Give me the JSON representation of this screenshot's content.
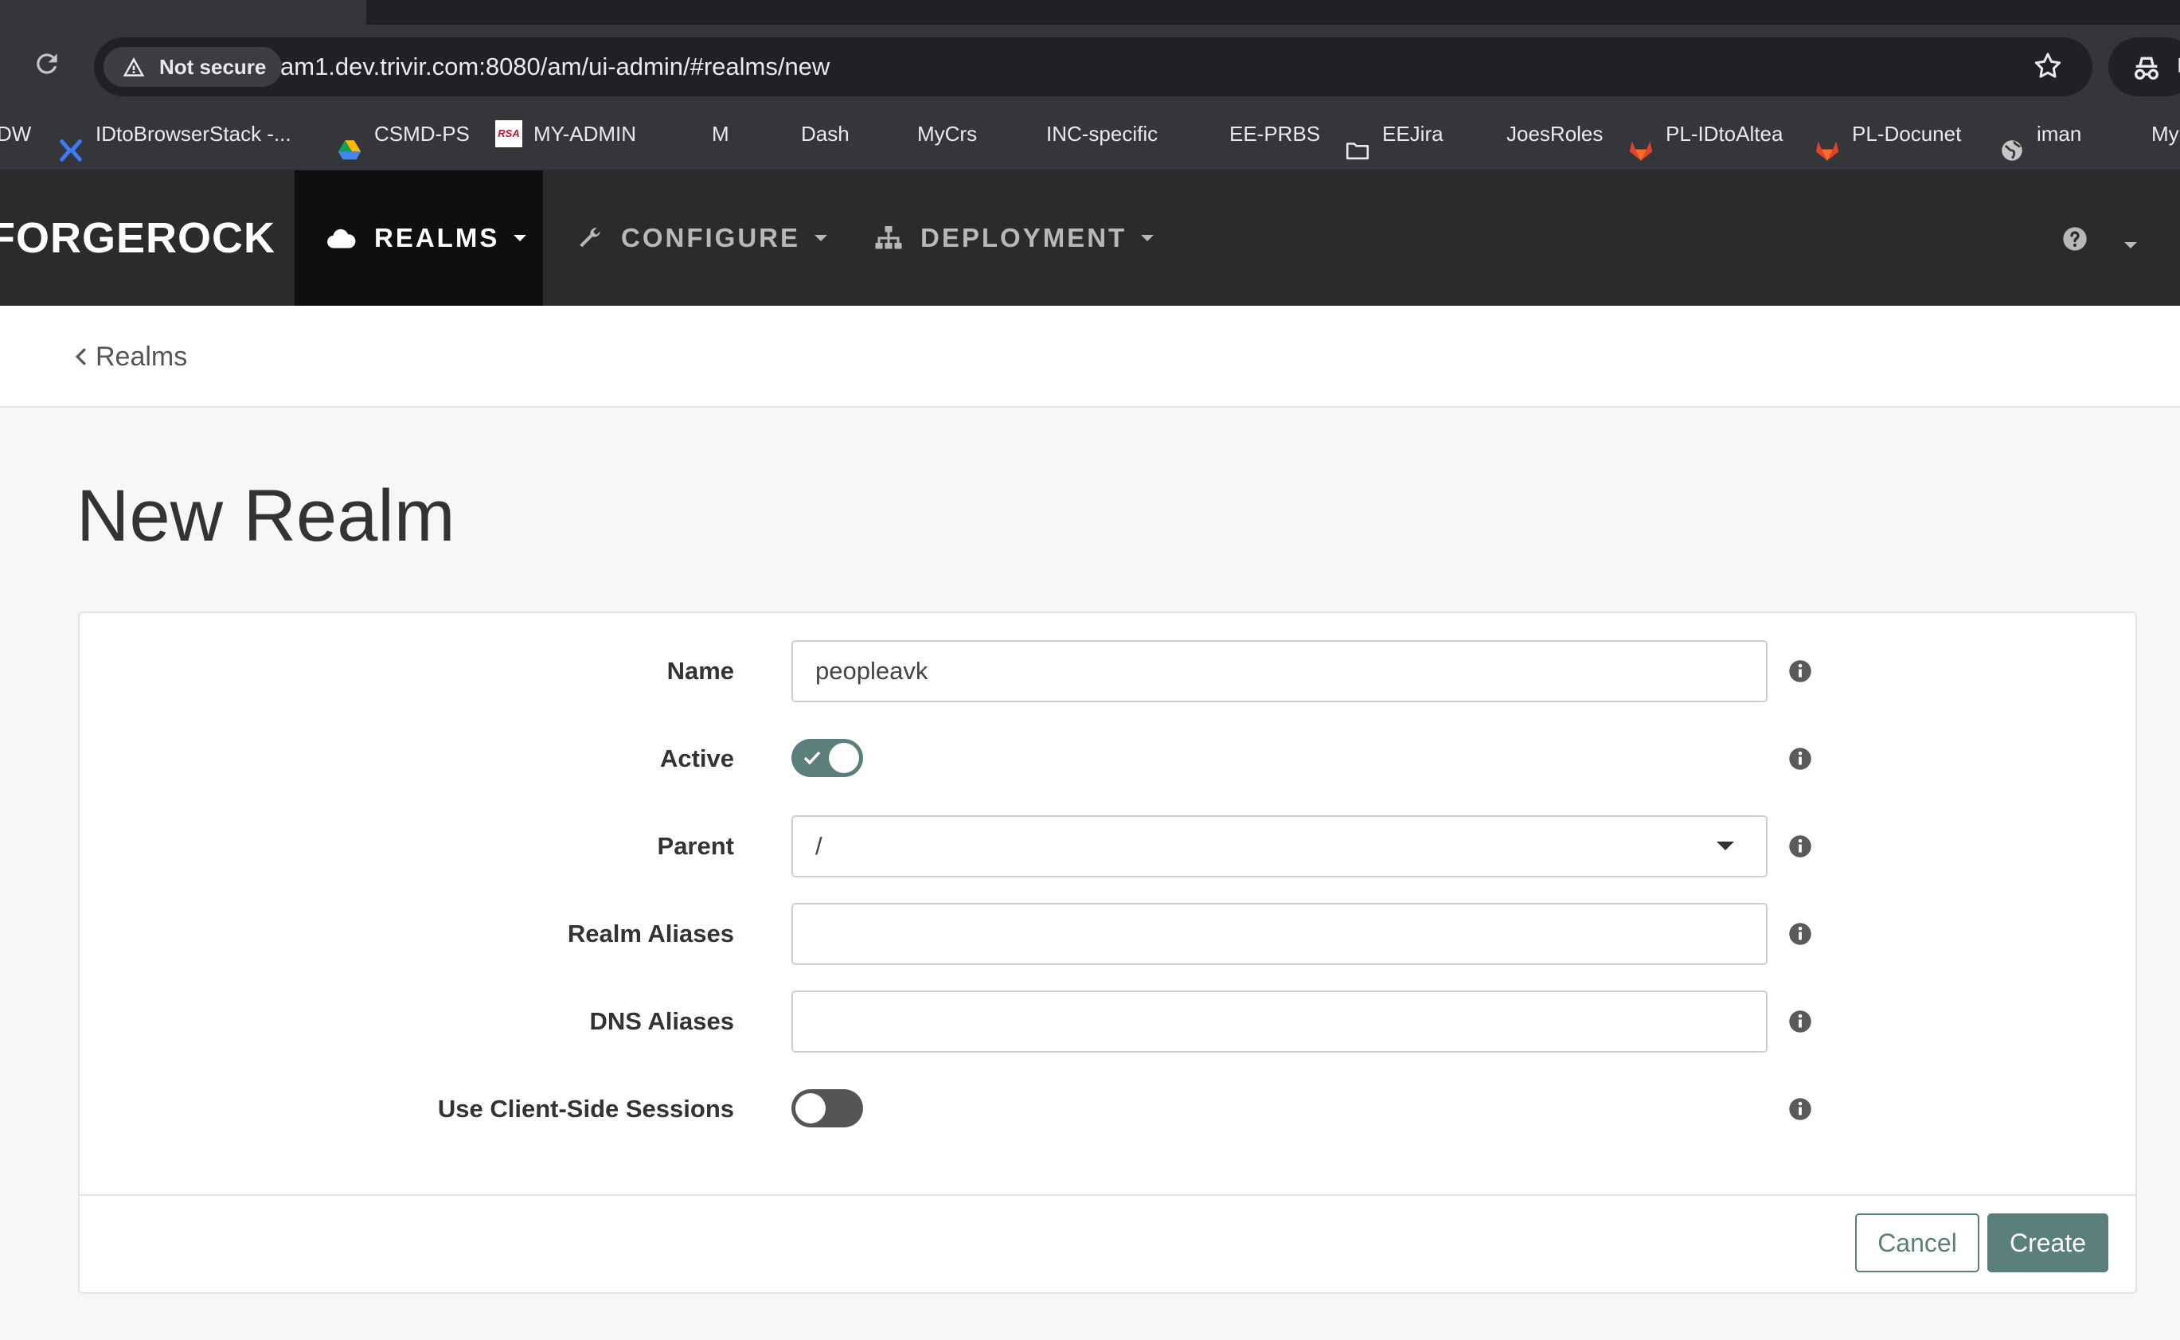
{
  "browser": {
    "security_label": "Not secure",
    "url": "am1.dev.trivir.com:8080/am/ui-admin/#realms/new",
    "profile_label": "I",
    "bookmarks": [
      {
        "label": "DW",
        "icon": "none"
      },
      {
        "label": "IDtoBrowserStack -...",
        "icon": "browserstack-icon"
      },
      {
        "label": "CSMD-PS",
        "icon": "google-drive-icon"
      },
      {
        "label": "MY-ADMIN",
        "icon": "rsa-icon"
      },
      {
        "label": "M",
        "icon": "microsoft-icon"
      },
      {
        "label": "Dash",
        "icon": "microsoft-icon"
      },
      {
        "label": "MyCrs",
        "icon": "microsoft-icon"
      },
      {
        "label": "INC-specific",
        "icon": "microsoft-icon"
      },
      {
        "label": "EE-PRBS",
        "icon": "microsoft-icon"
      },
      {
        "label": "EEJira",
        "icon": "folder-icon"
      },
      {
        "label": "JoesRoles",
        "icon": "microsoft-icon"
      },
      {
        "label": "PL-IDtoAltea",
        "icon": "gitlab-icon"
      },
      {
        "label": "PL-Docunet",
        "icon": "gitlab-icon"
      },
      {
        "label": "iman",
        "icon": "globe-icon"
      },
      {
        "label": "My",
        "icon": "microsoft-icon"
      }
    ]
  },
  "app": {
    "logo": "FORGEROCK",
    "nav": {
      "realms": "REALMS",
      "configure": "CONFIGURE",
      "deployment": "DEPLOYMENT"
    }
  },
  "breadcrumb": {
    "back_label": "Realms"
  },
  "page": {
    "title": "New Realm"
  },
  "form": {
    "name_label": "Name",
    "name_value": "peopleavk",
    "active_label": "Active",
    "active": true,
    "parent_label": "Parent",
    "parent_value": "/",
    "realm_aliases_label": "Realm Aliases",
    "realm_aliases_value": "",
    "dns_aliases_label": "DNS Aliases",
    "dns_aliases_value": "",
    "client_sessions_label": "Use Client-Side Sessions",
    "client_sessions": false
  },
  "actions": {
    "cancel": "Cancel",
    "create": "Create"
  },
  "colors": {
    "accent": "#5b7f7a",
    "header_bg": "#2b2b2b",
    "active_nav_bg": "#0f0f0f"
  }
}
